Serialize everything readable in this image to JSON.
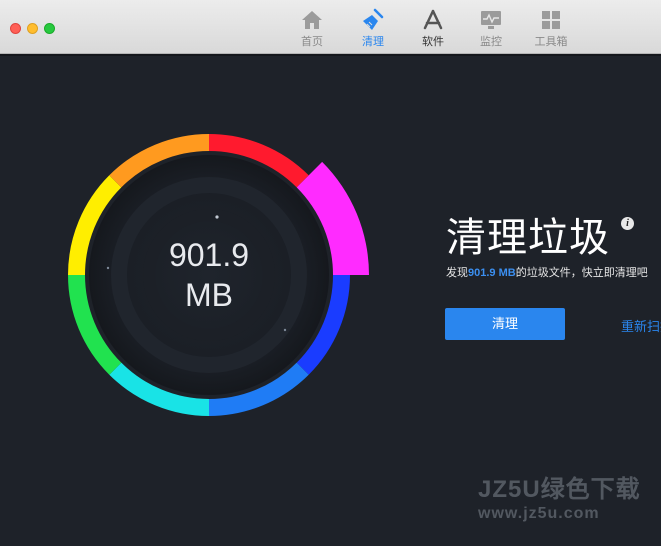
{
  "toolbar": {
    "tabs": [
      {
        "label": "首页",
        "icon": "home-icon"
      },
      {
        "label": "清理",
        "icon": "broom-icon",
        "active": true
      },
      {
        "label": "软件",
        "icon": "app-store-icon"
      },
      {
        "label": "监控",
        "icon": "monitor-icon"
      },
      {
        "label": "工具箱",
        "icon": "grid-icon"
      }
    ]
  },
  "gauge": {
    "value": "901.9",
    "unit": "MB",
    "ring_colors": [
      "#ffee00",
      "#ff9a1f",
      "#ff1a2e",
      "#ff2bff",
      "#1a3cff",
      "#1f7cf5",
      "#19e3e6",
      "#21e24f"
    ]
  },
  "content": {
    "heading": "清理垃圾",
    "desc_prefix": "发现",
    "desc_size": "901.9 MB",
    "desc_suffix": "的垃圾文件，快立即清理吧",
    "clean_button": "清理",
    "rescan_link": "重新扫描"
  },
  "watermark": {
    "line1": "JZ5U绿色下载",
    "line2": "www.jz5u.com"
  },
  "colors": {
    "accent": "#2a86ee",
    "background": "#1e2229"
  }
}
